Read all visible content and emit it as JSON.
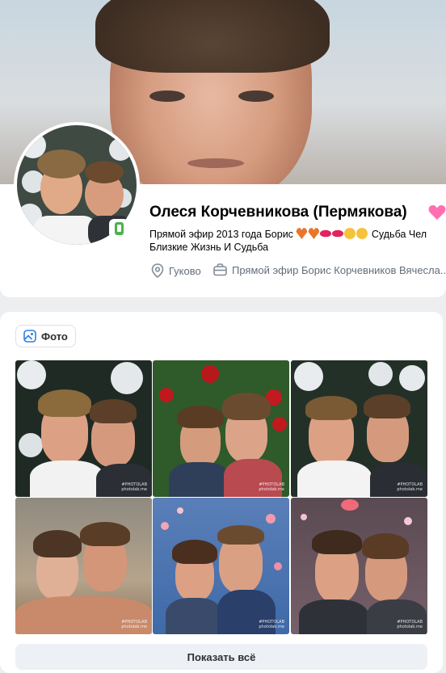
{
  "profile": {
    "name": "Олеся Корчевникова (Пермякова)",
    "status_text": "Прямой эфир 2013 года Борис",
    "status_tail": "Судьба Чел",
    "status_line2": "Близкие Жизнь И Судьба",
    "city": "Гуково",
    "job": "Прямой эфир Борис Корчевников Вячесла..."
  },
  "photos_section": {
    "tab_label": "Фото",
    "watermark_line1": "#PHOTOLAB",
    "watermark_line2": "photolab.me",
    "show_all_label": "Показать всё"
  },
  "colors": {
    "accent_heart": "#ff6fb1",
    "online": "#4bb34b",
    "secondary_text": "#626d7a"
  },
  "icons": [
    "pink-heart-icon",
    "phone-online-icon",
    "location-pin-icon",
    "briefcase-icon",
    "photo-icon"
  ]
}
